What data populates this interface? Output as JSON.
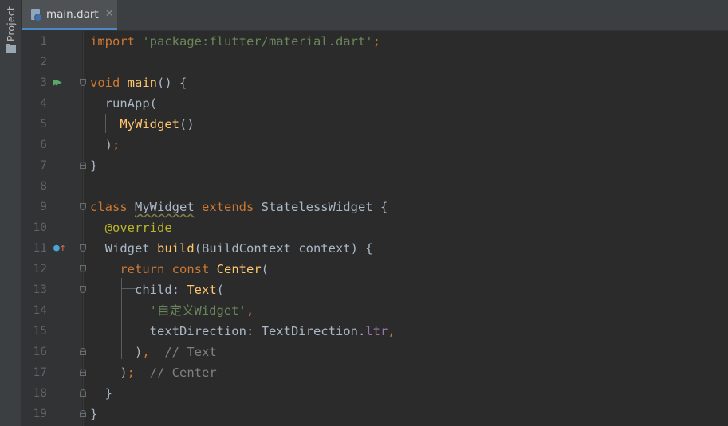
{
  "sidebar": {
    "project_label": "Project"
  },
  "editor_tab": {
    "file_name": "main.dart",
    "close_glyph": "✕"
  },
  "gutter_icons": {
    "run": "run-gutter-icon",
    "override": "override-gutter-icon"
  },
  "lines": [
    {
      "n": "1",
      "tokens": [
        {
          "t": "import ",
          "c": "kw"
        },
        {
          "t": "'package:flutter/material.dart'",
          "c": "str"
        },
        {
          "t": ";",
          "c": "kw"
        }
      ]
    },
    {
      "n": "2",
      "tokens": []
    },
    {
      "n": "3",
      "tokens": [
        {
          "t": "void ",
          "c": "kw"
        },
        {
          "t": "main",
          "c": "fn"
        },
        {
          "t": "() {",
          "c": ""
        }
      ]
    },
    {
      "n": "4",
      "tokens": [
        {
          "t": "  runApp(",
          "c": ""
        }
      ]
    },
    {
      "n": "5",
      "tokens": [
        {
          "t": "    ",
          "c": ""
        },
        {
          "t": "MyWidget",
          "c": "fn"
        },
        {
          "t": "()",
          "c": ""
        }
      ]
    },
    {
      "n": "6",
      "tokens": [
        {
          "t": "  )",
          "c": ""
        },
        {
          "t": ";",
          "c": "kw"
        }
      ]
    },
    {
      "n": "7",
      "tokens": [
        {
          "t": "}",
          "c": ""
        }
      ]
    },
    {
      "n": "8",
      "tokens": []
    },
    {
      "n": "9",
      "tokens": [
        {
          "t": "class ",
          "c": "kw"
        },
        {
          "t": "MyWidget",
          "c": "warn"
        },
        {
          "t": " extends ",
          "c": "kw"
        },
        {
          "t": "StatelessWidget {",
          "c": ""
        }
      ]
    },
    {
      "n": "10",
      "tokens": [
        {
          "t": "  ",
          "c": ""
        },
        {
          "t": "@override",
          "c": "ann"
        }
      ]
    },
    {
      "n": "11",
      "tokens": [
        {
          "t": "  Widget ",
          "c": ""
        },
        {
          "t": "build",
          "c": "fn"
        },
        {
          "t": "(BuildContext context) {",
          "c": ""
        }
      ]
    },
    {
      "n": "12",
      "tokens": [
        {
          "t": "    ",
          "c": ""
        },
        {
          "t": "return const ",
          "c": "kw"
        },
        {
          "t": "Center",
          "c": "fn"
        },
        {
          "t": "(",
          "c": ""
        }
      ]
    },
    {
      "n": "13",
      "tokens": [
        {
          "t": "    ",
          "c": ""
        },
        {
          "t": "  child: ",
          "c": ""
        },
        {
          "t": "Text",
          "c": "fn"
        },
        {
          "t": "(",
          "c": ""
        }
      ]
    },
    {
      "n": "14",
      "tokens": [
        {
          "t": "        ",
          "c": ""
        },
        {
          "t": "'自定义Widget'",
          "c": "str"
        },
        {
          "t": ",",
          "c": "kw"
        }
      ]
    },
    {
      "n": "15",
      "tokens": [
        {
          "t": "        textDirection: TextDirection.",
          "c": ""
        },
        {
          "t": "ltr",
          "c": "prop"
        },
        {
          "t": ",",
          "c": "kw"
        }
      ]
    },
    {
      "n": "16",
      "tokens": [
        {
          "t": "      )",
          "c": ""
        },
        {
          "t": ",",
          "c": "kw"
        },
        {
          "t": "  // Text",
          "c": "cmt"
        }
      ]
    },
    {
      "n": "17",
      "tokens": [
        {
          "t": "    )",
          "c": ""
        },
        {
          "t": ";",
          "c": "kw"
        },
        {
          "t": "  // Center",
          "c": "cmt"
        }
      ]
    },
    {
      "n": "18",
      "tokens": [
        {
          "t": "  }",
          "c": ""
        }
      ]
    },
    {
      "n": "19",
      "tokens": [
        {
          "t": "}",
          "c": ""
        }
      ]
    }
  ]
}
